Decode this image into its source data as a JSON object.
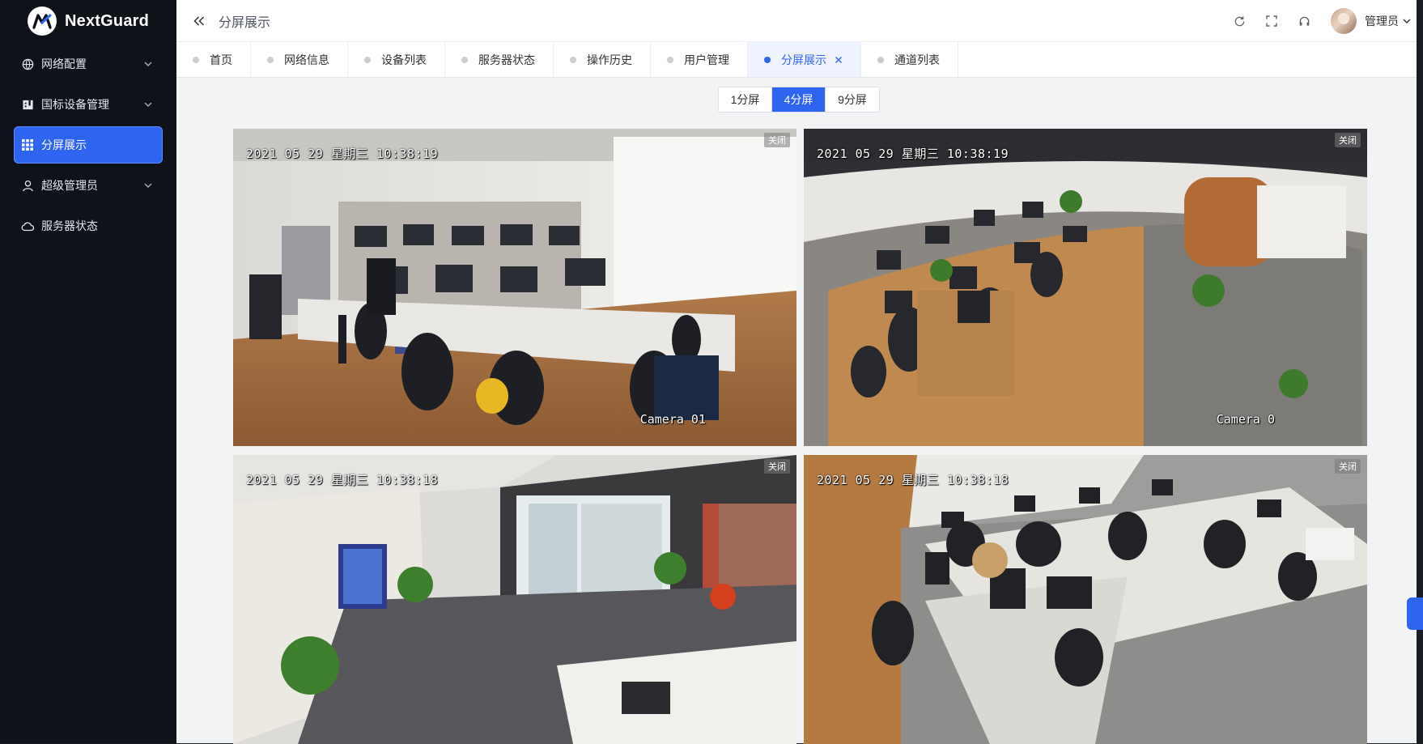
{
  "app": {
    "name": "NextGuard"
  },
  "sidebar": {
    "items": [
      {
        "label": "网络配置",
        "icon": "globe-icon",
        "has_children": true,
        "active": false
      },
      {
        "label": "国标设备管理",
        "icon": "building-icon",
        "has_children": true,
        "active": false
      },
      {
        "label": "分屏展示",
        "icon": "grid-icon",
        "has_children": false,
        "active": true
      },
      {
        "label": "超级管理员",
        "icon": "user-icon",
        "has_children": true,
        "active": false
      },
      {
        "label": "服务器状态",
        "icon": "cloud-icon",
        "has_children": false,
        "active": false
      }
    ]
  },
  "header": {
    "breadcrumb": "分屏展示",
    "tools": [
      "refresh-icon",
      "fullscreen-icon",
      "headset-icon"
    ],
    "user_name": "管理员"
  },
  "tabs": [
    {
      "label": "首页",
      "active": false
    },
    {
      "label": "网络信息",
      "active": false
    },
    {
      "label": "设备列表",
      "active": false
    },
    {
      "label": "服务器状态",
      "active": false
    },
    {
      "label": "操作历史",
      "active": false
    },
    {
      "label": "用户管理",
      "active": false
    },
    {
      "label": "分屏展示",
      "active": true,
      "closable": true
    },
    {
      "label": "通道列表",
      "active": false
    }
  ],
  "layout_switch": {
    "options": [
      "1分屏",
      "4分屏",
      "9分屏"
    ],
    "selected": "4分屏"
  },
  "cameras": [
    {
      "timestamp": "2021 05 29 星期三 10:38:19",
      "label": "Camera 01",
      "close_label": "关闭"
    },
    {
      "timestamp": "2021 05 29 星期三 10:38:19",
      "label": "Camera 0",
      "close_label": "关闭"
    },
    {
      "timestamp": "2021 05 29 星期三 10:38:18",
      "label": "",
      "close_label": "关闭"
    },
    {
      "timestamp": "2021 05 29 星期三 10:38:18",
      "label": "",
      "close_label": "关闭"
    }
  ],
  "colors": {
    "accent": "#2f64f1",
    "sidebar_bg": "#0f1219",
    "content_bg": "#f2f3f5"
  }
}
